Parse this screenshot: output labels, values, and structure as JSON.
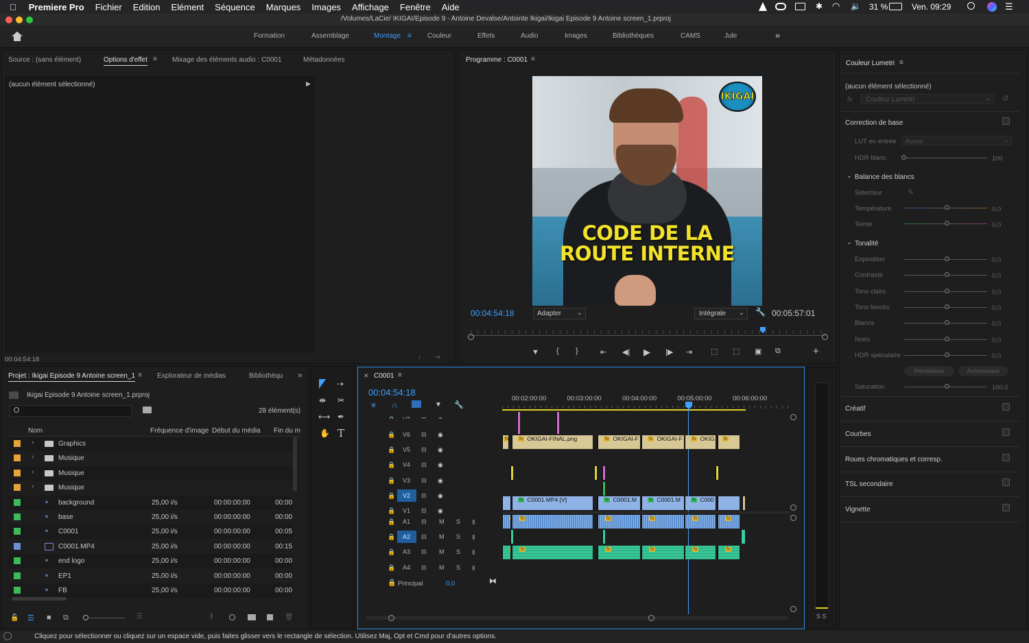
{
  "menubar": {
    "app": "Premiere Pro",
    "items": [
      "Fichier",
      "Edition",
      "Elément",
      "Séquence",
      "Marques",
      "Images",
      "Affichage",
      "Fenêtre",
      "Aide"
    ],
    "battery": "31 %",
    "clock": "Ven. 09:29"
  },
  "title": "/Volumes/LaCie/ IKIGAI/Episode 9 - Antoine  Devalse/Antointe Ikigai/Ikigai Episode 9 Antoine screen_1.prproj",
  "workspaces": {
    "items": [
      "Formation",
      "Assemblage",
      "Montage",
      "Couleur",
      "Effets",
      "Audio",
      "Images",
      "Bibliothèques",
      "CAMS",
      "Jule"
    ],
    "active": "Montage"
  },
  "source_panel": {
    "tabs": [
      "Source : (sans élément)",
      "Options d'effet",
      "Mixage des éléments audio : C0001",
      "Métadonnées"
    ],
    "active_tab": "Options d'effet",
    "empty_label": "(aucun élément sélectionné)",
    "timecode": "00:04:54:18"
  },
  "program": {
    "title": "Programme : C0001",
    "timecode": "00:04:54:18",
    "fit": "Adapter",
    "quality": "Intégrale",
    "duration": "00:05:57:01",
    "overlay_line1": "CODE DE LA",
    "overlay_line2": "ROUTE INTERNE",
    "logo": "IKIGAI",
    "playhead_fraction": 0.815
  },
  "lumetri": {
    "title": "Couleur Lumetri",
    "empty_label": "(aucun élément sélectionné)",
    "fx_select": "Couleur Lumetri",
    "basic": "Correction de base",
    "lut_label": "LUT en entrée",
    "lut_value": "Aucun",
    "hdr_label": "HDR blanc",
    "hdr_value": "100",
    "wb_header": "Balance des blancs",
    "selector_label": "Sélecteur",
    "temperature": {
      "label": "Température",
      "value": "0,0"
    },
    "tint": {
      "label": "Teinte",
      "value": "0,0"
    },
    "tone_header": "Tonalité",
    "tones": [
      {
        "label": "Exposition",
        "value": "0,0"
      },
      {
        "label": "Contraste",
        "value": "0,0"
      },
      {
        "label": "Tons clairs",
        "value": "0,0"
      },
      {
        "label": "Tons foncés",
        "value": "0,0"
      },
      {
        "label": "Blancs",
        "value": "0,0"
      },
      {
        "label": "Noirs",
        "value": "0,0"
      },
      {
        "label": "HDR spéculaire",
        "value": "0,0"
      }
    ],
    "reset": "Réinitialiser",
    "auto": "Automatique",
    "saturation": {
      "label": "Saturation",
      "value": "100,0"
    },
    "sections": [
      "Créatif",
      "Courbes",
      "Roues chromatiques et corresp.",
      "TSL secondaire",
      "Vignette"
    ]
  },
  "project": {
    "tabs": [
      "Projet : Ikigai Episode 9 Antoine screen_1",
      "Explorateur de médias",
      "Bibliothèqu"
    ],
    "active_tab": "Projet : Ikigai Episode 9 Antoine screen_1",
    "file": "Ikigai Episode 9 Antoine screen_1.prproj",
    "count": "28 élément(s)",
    "columns": [
      "Nom",
      "Fréquence d'image",
      "Début du média",
      "Fin du m"
    ],
    "rows": [
      {
        "name": "Graphics",
        "type": "folder",
        "color": "#e8a23a",
        "fps": "",
        "start": "",
        "end": ""
      },
      {
        "name": "Musique",
        "type": "folder",
        "color": "#e8a23a",
        "fps": "",
        "start": "",
        "end": ""
      },
      {
        "name": "Musique",
        "type": "folder",
        "color": "#e8a23a",
        "fps": "",
        "start": "",
        "end": ""
      },
      {
        "name": "Musique",
        "type": "folder",
        "color": "#e8a23a",
        "fps": "",
        "start": "",
        "end": ""
      },
      {
        "name": "background",
        "type": "sequence",
        "color": "#3dbb5b",
        "fps": "25,00 i/s",
        "start": "00:00:00:00",
        "end": "00:00"
      },
      {
        "name": "base",
        "type": "sequence",
        "color": "#3dbb5b",
        "fps": "25,00 i/s",
        "start": "00:00:00:00",
        "end": "00:00"
      },
      {
        "name": "C0001",
        "type": "sequence",
        "color": "#3dbb5b",
        "fps": "25,00 i/s",
        "start": "00:00:00:00",
        "end": "00:05"
      },
      {
        "name": "C0001.MP4",
        "type": "clip",
        "color": "#6d8fd6",
        "fps": "25,00 i/s",
        "start": "00:00:00:00",
        "end": "00:15"
      },
      {
        "name": "end logo",
        "type": "sequence",
        "color": "#3dbb5b",
        "fps": "25,00 i/s",
        "start": "00:00:00:00",
        "end": "00:00"
      },
      {
        "name": "EP1",
        "type": "sequence",
        "color": "#3dbb5b",
        "fps": "25,00 i/s",
        "start": "00:00:00:00",
        "end": "00:00"
      },
      {
        "name": "FB",
        "type": "sequence",
        "color": "#3dbb5b",
        "fps": "25,00 i/s",
        "start": "00:00:00:00",
        "end": "00:00"
      }
    ]
  },
  "timeline": {
    "sequence": "C0001",
    "timecode": "00:04:54:18",
    "ruler": [
      "00:02:00:00",
      "00:03:00:00",
      "00:04:00:00",
      "00:05:00:00",
      "00:06:00:00"
    ],
    "video_tracks": [
      "V7",
      "V6",
      "V5",
      "V4",
      "V3",
      "V2",
      "V1"
    ],
    "audio_tracks": [
      "A1",
      "A2",
      "A3",
      "A4"
    ],
    "mute": "M",
    "solo": "S",
    "master_label": "Principal",
    "master_value": "0,0",
    "clips_v5": [
      "OKIGAI-FINAL.png",
      "OKIGAI-F",
      "OKIGAI-F",
      "OKIG"
    ],
    "clips_v1": [
      "C0001.MP4 [V]",
      "C0001.M",
      "C0001.M",
      "C000"
    ]
  },
  "meter": {
    "labels": "S S"
  },
  "status": "Cliquez pour sélectionner ou cliquez sur un espace vide, puis faites glisser vers le rectangle de sélection. Utilisez Maj, Opt et Cmd pour d'autres options.",
  "colors": {
    "accent": "#2d8ceb",
    "timecode": "#3fa0ff",
    "yellow_text": "#f2e22a"
  }
}
